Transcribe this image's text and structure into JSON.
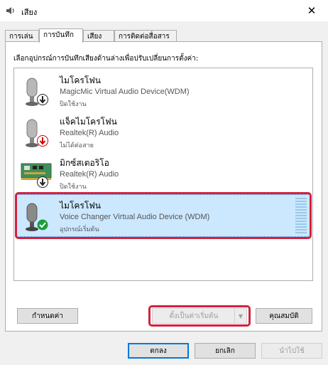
{
  "window": {
    "title": "เสียง",
    "close_glyph": "✕"
  },
  "tabs": [
    {
      "label": "การเล่น"
    },
    {
      "label": "การบันทึก"
    },
    {
      "label": "เสียง"
    },
    {
      "label": "การติดต่อสื่อสาร"
    }
  ],
  "panel": {
    "instruction": "เลือกอุปกรณ์การบันทึกเสียงด้านล่างเพื่อปรับเปลี่ยนการตั้งค่า:"
  },
  "devices": [
    {
      "name": "ไมโครโฟน",
      "description": "MagicMic Virtual Audio Device(WDM)",
      "status": "ปิดใช้งาน",
      "icon": "microphone-icon",
      "badge": "down-arrow-black",
      "selected": false
    },
    {
      "name": "แจ็คไมโครโฟน",
      "description": "Realtek(R) Audio",
      "status": "ไม่ได้ต่อสาย",
      "icon": "microphone-icon",
      "badge": "down-arrow-red",
      "selected": false
    },
    {
      "name": "มิกซ์สเตอริโอ",
      "description": "Realtek(R) Audio",
      "status": "ปิดใช้งาน",
      "icon": "sound-card-icon",
      "badge": "down-arrow-black",
      "selected": false
    },
    {
      "name": "ไมโครโฟน",
      "description": "Voice Changer Virtual Audio Device (WDM)",
      "status": "อุปกรณ์เริ่มต้น",
      "icon": "microphone-icon",
      "badge": "green-check",
      "selected": true
    }
  ],
  "buttons": {
    "configure": "กำหนดค่า",
    "set_default": "ตั้งเป็นค่าเริ่มต้น",
    "properties": "คุณสมบัติ",
    "ok": "ตกลง",
    "cancel": "ยกเลิก",
    "apply": "นำไปใช้"
  },
  "colors": {
    "highlight": "#d5203f",
    "selection": "#cce8ff",
    "accent": "#0078d7"
  }
}
